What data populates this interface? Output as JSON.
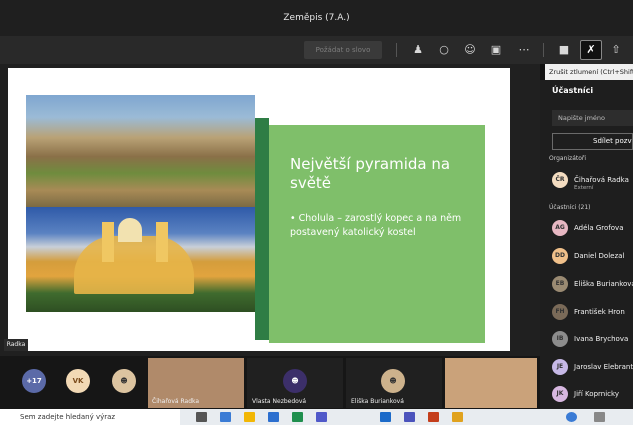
{
  "window": {
    "title": "Zeměpis (7.A.)"
  },
  "toolbar": {
    "raise_hand": "Požádat o slovo",
    "icons": [
      "people-icon",
      "chat-icon",
      "reactions-icon",
      "rooms-icon",
      "more-icon",
      "camera-icon",
      "mic-off-icon",
      "share-icon"
    ]
  },
  "tooltip": "Zrušit ztlumení (Ctrl+Shift+M)",
  "slide": {
    "title": "Největší pyramida na světě",
    "bullet": "• Cholula – zarostlý kopec a na něm postavený katolický kostel"
  },
  "presenter_label": "Radka",
  "panel": {
    "title": "Účastníci",
    "name_placeholder": "Napište jméno",
    "share_label": "Sdílet pozvánku",
    "organizers_label": "Organizátoři",
    "organizer": {
      "name": "Čihařová Radka",
      "sub": "Externí",
      "initials": "ČR"
    },
    "participants_label": "Účastníci (21)",
    "participants": [
      {
        "initials": "AG",
        "name": "Adéla Grofova",
        "color": "#e7b7c2"
      },
      {
        "initials": "DD",
        "name": "Daniel Dolezal",
        "color": "#f0c08a"
      },
      {
        "initials": "EB",
        "name": "Eliška Burianková",
        "color": "#9a8a72"
      },
      {
        "initials": "FH",
        "name": "František Hron",
        "color": "#7a6a58"
      },
      {
        "initials": "IB",
        "name": "Ivana Brychova",
        "color": "#8c8c8c"
      },
      {
        "initials": "JE",
        "name": "Jaroslav Elebrant",
        "color": "#c6b8e6"
      },
      {
        "initials": "JK",
        "name": "Jiří Koprnicky",
        "color": "#d7b7e0"
      }
    ]
  },
  "bottom": {
    "more_count": "+17",
    "vk_initials": "VK",
    "videos": [
      "Čihařová Radka",
      "Vlasta Nezbedová",
      "Eliška Burianková",
      ""
    ]
  },
  "taskbar": {
    "search": "Sem zadejte hledaný výraz"
  },
  "colors": {
    "accent": "#7fbf6a",
    "dark_green": "#2f7d45"
  }
}
